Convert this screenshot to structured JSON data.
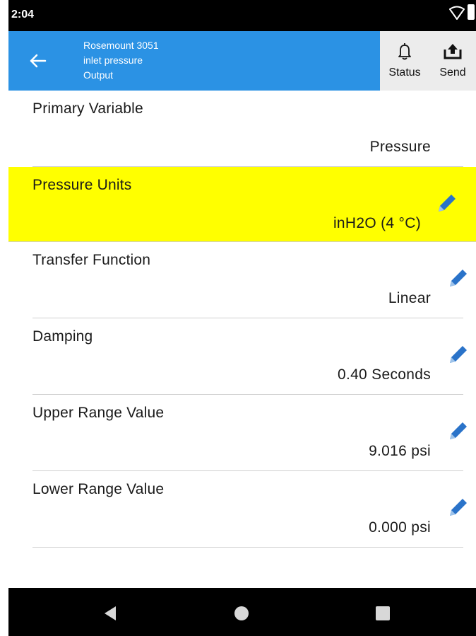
{
  "status_bar": {
    "time": "2:04"
  },
  "app_bar": {
    "title_line1": "Rosemount 3051",
    "title_line2": "inlet pressure",
    "title_line3": "Output",
    "status_label": "Status",
    "send_label": "Send"
  },
  "rows": [
    {
      "label": "Primary Variable",
      "value": "Pressure",
      "editable": false,
      "highlighted": false
    },
    {
      "label": "Pressure Units",
      "value": "inH2O (4 °C)",
      "editable": true,
      "highlighted": true
    },
    {
      "label": "Transfer Function",
      "value": "Linear",
      "editable": true,
      "highlighted": false
    },
    {
      "label": "Damping",
      "value": "0.40 Seconds",
      "editable": true,
      "highlighted": false
    },
    {
      "label": "Upper Range Value",
      "value": "9.016 psi",
      "editable": true,
      "highlighted": false
    },
    {
      "label": "Lower Range Value",
      "value": "0.000 psi",
      "editable": true,
      "highlighted": false
    }
  ],
  "colors": {
    "app_bar": "#2b92e4",
    "highlight": "#ffff00",
    "edit_icon": "#2a73c9"
  },
  "icons": {
    "back": "arrow-left-icon",
    "status": "bell-icon",
    "send": "upload-icon",
    "edit": "pencil-icon"
  }
}
